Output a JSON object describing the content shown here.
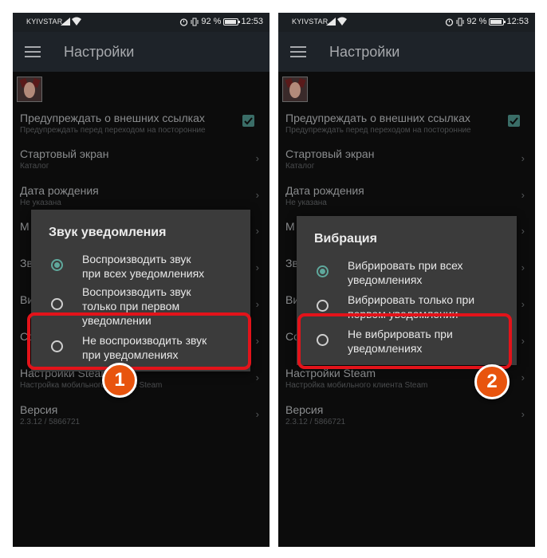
{
  "statusbar": {
    "carrier": "KYIVSTAR",
    "battery": "92 %",
    "time": "12:53"
  },
  "appbar": {
    "title": "Настройки"
  },
  "settings": [
    {
      "title": "Предупреждать о внешних ссылках",
      "sub": "Предупреждать перед переходом на посторонние"
    },
    {
      "title": "Стартовый экран",
      "sub": "Каталог"
    },
    {
      "title": "Дата рождения",
      "sub": "Не указана"
    },
    {
      "title": "Настройки Steam",
      "sub": "Настройка мобильного клиента Steam"
    },
    {
      "title": "Версия",
      "sub": "2.3.12 / 5866721"
    }
  ],
  "partial_rows": {
    "r4": "М",
    "r5": "Зв",
    "r6": "Ви",
    "r7": "Со"
  },
  "dialogs": {
    "sound": {
      "title": "Звук уведомления",
      "options": [
        {
          "line1": "Воспроизводить звук",
          "line2": "при всех уведомлениях",
          "selected": true
        },
        {
          "line1": "Воспроизводить звук",
          "line2": "только при первом",
          "line3": "уведомлении",
          "selected": false
        },
        {
          "line1": "Не воспроизводить звук",
          "line2": "при уведомлениях",
          "selected": false
        }
      ]
    },
    "vibration": {
      "title": "Вибрация",
      "options": [
        {
          "line1": "Вибрировать при всех",
          "line2": "уведомлениях",
          "selected": true
        },
        {
          "line1": "Вибрировать только при",
          "line2": "первом уведомлении",
          "selected": false
        },
        {
          "line1": "Не вибрировать при",
          "line2": "уведомлениях",
          "selected": false
        }
      ]
    }
  },
  "badges": {
    "first": "1",
    "second": "2"
  },
  "colors": {
    "accent_radio": "#5fa89c",
    "highlight": "#e3131a",
    "badge": "#e8540e"
  }
}
